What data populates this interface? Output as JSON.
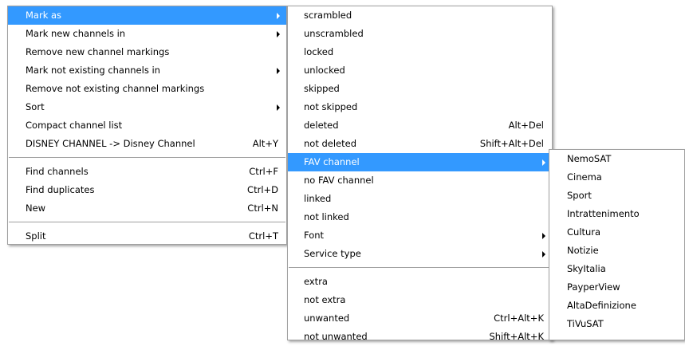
{
  "main_menu": {
    "items": [
      {
        "label": "Mark as",
        "shortcut": "",
        "submenu": true,
        "highlighted": true
      },
      {
        "label": "Mark new channels in",
        "shortcut": "",
        "submenu": true
      },
      {
        "label": "Remove new channel markings",
        "shortcut": "",
        "submenu": false
      },
      {
        "label": "Mark not existing channels in",
        "shortcut": "",
        "submenu": true
      },
      {
        "label": "Remove not existing channel markings",
        "shortcut": "",
        "submenu": false
      },
      {
        "label": "Sort",
        "shortcut": "",
        "submenu": true
      },
      {
        "label": "Compact channel list",
        "shortcut": "",
        "submenu": false
      },
      {
        "label": "DISNEY CHANNEL -> Disney Channel",
        "shortcut": "Alt+Y",
        "submenu": false
      },
      {
        "label": "Find channels",
        "shortcut": "Ctrl+F",
        "submenu": false
      },
      {
        "label": "Find duplicates",
        "shortcut": "Ctrl+D",
        "submenu": false
      },
      {
        "label": "New",
        "shortcut": "Ctrl+N",
        "submenu": false
      },
      {
        "label": "Split",
        "shortcut": "Ctrl+T",
        "submenu": false
      }
    ]
  },
  "mark_as_menu": {
    "items": [
      {
        "label": "scrambled",
        "shortcut": ""
      },
      {
        "label": "unscrambled",
        "shortcut": ""
      },
      {
        "label": "locked",
        "shortcut": ""
      },
      {
        "label": "unlocked",
        "shortcut": ""
      },
      {
        "label": "skipped",
        "shortcut": ""
      },
      {
        "label": "not skipped",
        "shortcut": ""
      },
      {
        "label": "deleted",
        "shortcut": "Alt+Del"
      },
      {
        "label": "not deleted",
        "shortcut": "Shift+Alt+Del"
      },
      {
        "label": "FAV channel",
        "shortcut": "",
        "submenu": true,
        "highlighted": true
      },
      {
        "label": "no FAV channel",
        "shortcut": ""
      },
      {
        "label": "linked",
        "shortcut": ""
      },
      {
        "label": "not linked",
        "shortcut": ""
      },
      {
        "label": "Font",
        "shortcut": "",
        "submenu": true
      },
      {
        "label": "Service type",
        "shortcut": "",
        "submenu": true
      },
      {
        "label": "extra",
        "shortcut": ""
      },
      {
        "label": "not extra",
        "shortcut": ""
      },
      {
        "label": "unwanted",
        "shortcut": "Ctrl+Alt+K"
      },
      {
        "label": "not unwanted",
        "shortcut": "Shift+Alt+K"
      }
    ]
  },
  "fav_menu": {
    "items": [
      {
        "label": "NemoSAT"
      },
      {
        "label": "Cinema"
      },
      {
        "label": "Sport"
      },
      {
        "label": "Intrattenimento"
      },
      {
        "label": "Cultura"
      },
      {
        "label": "Notizie"
      },
      {
        "label": "SkyItalia"
      },
      {
        "label": "PayperView"
      },
      {
        "label": "AltaDefinizione"
      },
      {
        "label": "TiVuSAT"
      }
    ]
  },
  "colors": {
    "highlight": "#3399ff",
    "border": "#a0a0a0",
    "background": "#ffffff"
  }
}
